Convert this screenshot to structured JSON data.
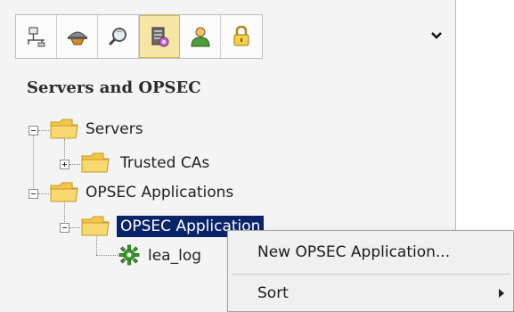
{
  "toolbar": {
    "buttons": [
      {
        "icon": "network-objects-icon",
        "active": false
      },
      {
        "icon": "services-icon",
        "active": false
      },
      {
        "icon": "resources-icon",
        "active": false
      },
      {
        "icon": "servers-opsec-icon",
        "active": true
      },
      {
        "icon": "users-icon",
        "active": false
      },
      {
        "icon": "vpn-communities-icon",
        "active": false
      }
    ],
    "more_icon": "chevron-down-icon"
  },
  "panel": {
    "title": "Servers and OPSEC"
  },
  "tree": {
    "servers": "Servers",
    "trusted_cas": "Trusted CAs",
    "opsec_applications": "OPSEC Applications",
    "opsec_application": "OPSEC Application",
    "lea_log": "lea_log"
  },
  "context_menu": {
    "items": [
      {
        "label": "New OPSEC Application..."
      },
      {
        "label": "Sort",
        "has_submenu": true
      }
    ]
  },
  "colors": {
    "selection": "#0a246a",
    "folder": "#f3c64b",
    "active_tab": "#f6e5a4"
  }
}
